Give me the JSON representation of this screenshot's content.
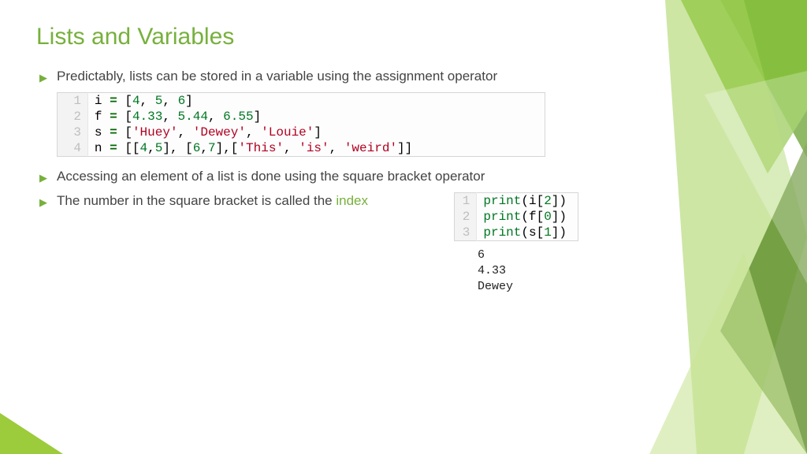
{
  "title": "Lists and Variables",
  "bullets": {
    "b1": "Predictably, lists can be stored in a variable using the assignment operator",
    "b2": "Accessing an element of a list is done using the square bracket operator",
    "b3a": "The number in the square bracket is called the ",
    "b3_index": "index"
  },
  "code1": {
    "lines": [
      "1",
      "2",
      "3",
      "4"
    ],
    "l1": {
      "a": "i ",
      "b": "= ",
      "c": "[",
      "d": "4",
      "e": ", ",
      "f": "5",
      "g": ", ",
      "h": "6",
      "i": "]"
    },
    "l2": {
      "a": "f ",
      "b": "= ",
      "c": "[",
      "d": "4.33",
      "e": ", ",
      "f": "5.44",
      "g": ", ",
      "h": "6.55",
      "i": "]"
    },
    "l3": {
      "a": "s ",
      "b": "= ",
      "c": "[",
      "d": "'Huey'",
      "e": ", ",
      "f": "'Dewey'",
      "g": ", ",
      "h": "'Louie'",
      "i": "]"
    },
    "l4": {
      "a": "n ",
      "b": "= ",
      "c": "[[",
      "d": "4",
      "e": ",",
      "f": "5",
      "g": "], [",
      "h": "6",
      "i": ",",
      "j": "7",
      "k": "],[",
      "l": "'This'",
      "m": ", ",
      "n": "'is'",
      "o": ", ",
      "p": "'weird'",
      "q": "]]"
    }
  },
  "code2": {
    "lines": [
      "1",
      "2",
      "3"
    ],
    "l1": {
      "a": "print",
      "b": "(i[",
      "c": "2",
      "d": "])"
    },
    "l2": {
      "a": "print",
      "b": "(f[",
      "c": "0",
      "d": "])"
    },
    "l3": {
      "a": "print",
      "b": "(s[",
      "c": "1",
      "d": "])"
    }
  },
  "output": {
    "o1": "6",
    "o2": "4.33",
    "o3": "Dewey"
  },
  "colors": {
    "accent": "#77b03c"
  }
}
